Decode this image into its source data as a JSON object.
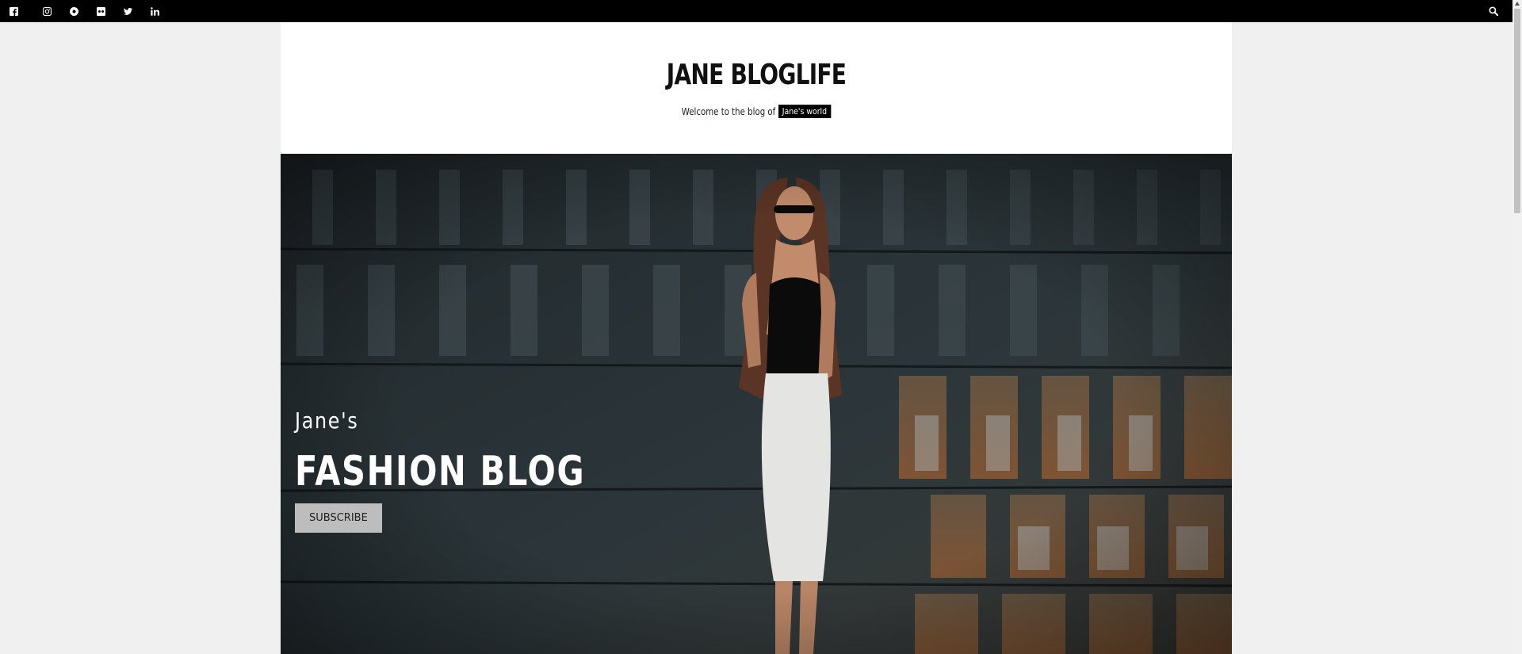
{
  "topbar": {
    "social_icons": [
      "facebook-icon",
      "instagram-icon",
      "medium-icon",
      "flickr-icon",
      "twitter-icon",
      "linkedin-icon"
    ],
    "search_icon": "search-icon"
  },
  "header": {
    "site_title": "JANE BLOGLIFE",
    "tagline_text": "Welcome to the blog of",
    "tagline_highlight": "Jane's world"
  },
  "hero": {
    "kicker": "Jane's",
    "title": "FASHION BLOG",
    "button_label": "SUBSCRIBE"
  },
  "colors": {
    "topbar": "#000000",
    "page_bg": "#f0f0f0",
    "container_bg": "#ffffff",
    "button_bg": "#bdbdbd"
  }
}
